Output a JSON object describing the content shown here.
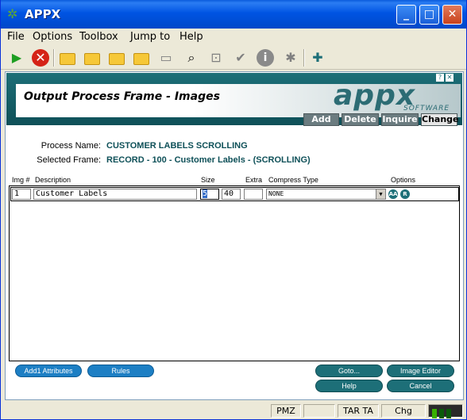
{
  "window": {
    "title": "APPX",
    "icon": "appx-app-icon"
  },
  "titlebar_buttons": {
    "minimize": "_",
    "maximize": "□",
    "close": "✕"
  },
  "menu": [
    "File",
    "Options",
    "Toolbox",
    "Jump to",
    "Help"
  ],
  "toolbar": {
    "icons": [
      "go-icon",
      "stop-icon",
      "folder-new-icon",
      "folder-edit-icon",
      "folder-open-icon",
      "folder-delete-icon",
      "tv-icon",
      "search-icon",
      "zoom-icon",
      "check-icon",
      "info-icon",
      "bug-icon",
      "tools-icon"
    ]
  },
  "header": {
    "page_title": "Output Process Frame - Images",
    "logo": "appx",
    "logo_sub": "SOFTWARE",
    "help_mark": "?",
    "close_mark": "✕",
    "modes": [
      "Add",
      "Delete",
      "Inquire",
      "Change"
    ],
    "active_mode": "Change"
  },
  "form": {
    "process_name_label": "Process Name:",
    "process_name": "CUSTOMER LABELS SCROLLING",
    "selected_frame_label": "Selected Frame:",
    "selected_frame": "RECORD - 100 - Customer Labels - (SCROLLING)"
  },
  "table": {
    "columns": [
      "Img #",
      "Description",
      "Size",
      "Extra",
      "Compress Type",
      "Options"
    ],
    "rows": [
      {
        "img": "1",
        "description": "Customer Labels",
        "size_a": "5",
        "size_b": "40",
        "extra": "",
        "compress": "NONE",
        "opt1": "AA",
        "opt2": "R"
      }
    ]
  },
  "buttons": {
    "addl_attributes": "Add1 Attributes",
    "rules": "Rules",
    "goto": "Goto...",
    "image_editor": "Image Editor",
    "help": "Help",
    "cancel": "Cancel"
  },
  "statusbar": {
    "cells": [
      "PMZ",
      "",
      "TAR TA",
      "Chg"
    ]
  },
  "colors": {
    "brand_teal": "#1d6f78",
    "accent_blue": "#1d7fc4",
    "titlebar": "#0054e3"
  }
}
